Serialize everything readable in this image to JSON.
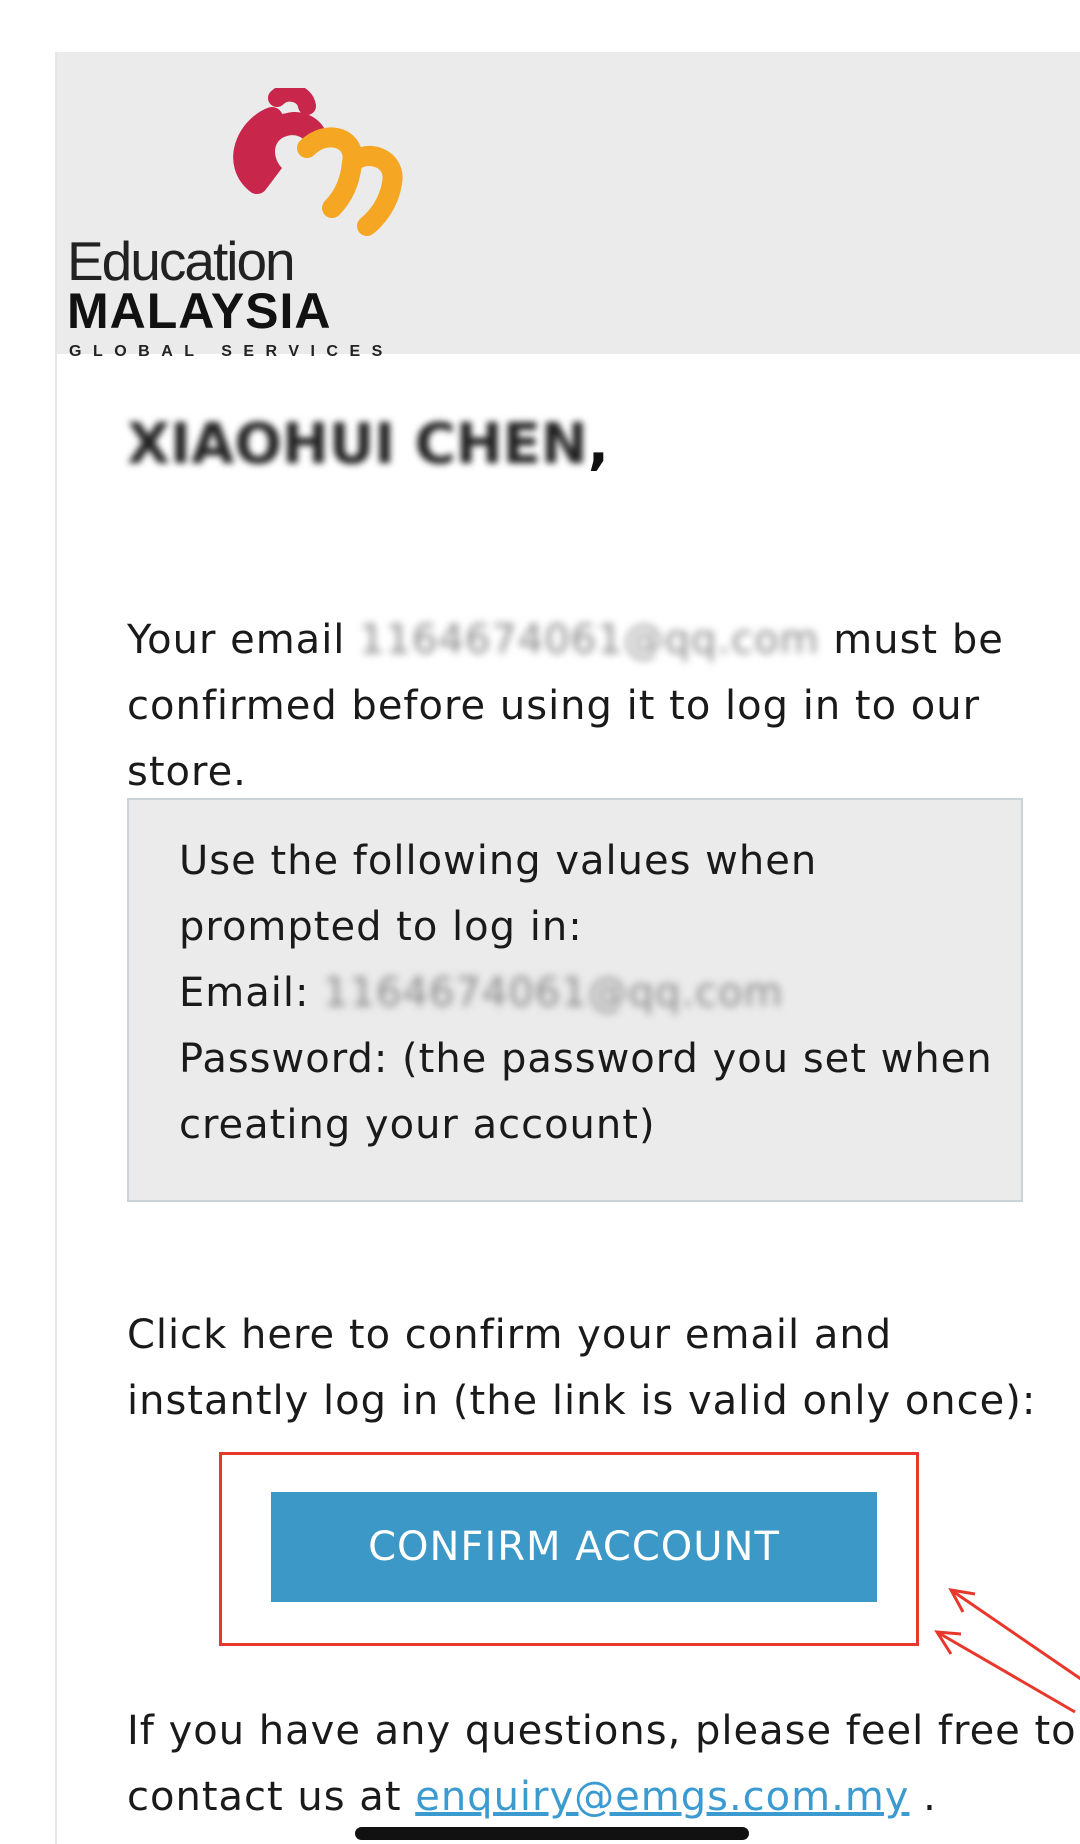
{
  "header": {
    "logo": {
      "word_top": "Education",
      "word_main": "MALAYSIA",
      "word_sub": "GLOBAL SERVICES",
      "mark_colors": [
        "#c8264a",
        "#f5a623"
      ]
    }
  },
  "email": {
    "greeting_name": "XIAOHUI CHEN",
    "greeting_punct": ",",
    "intro_before": "Your email ",
    "intro_email_redacted": "1164674061@qq.com",
    "intro_after": " must be confirmed before using it to log in to our store.",
    "credentials": {
      "line1": "Use the following values when prompted to log in:",
      "email_label": "Email: ",
      "email_value_redacted": "1164674061@qq.com",
      "password_line": "Password: (the password you set when creating your account)"
    },
    "click_here_text": "Click here to confirm your email and instantly log in (the link is valid only once):",
    "confirm_button_label": "CONFIRM ACCOUNT",
    "questions_text": "If you have any questions, please feel free to contact us at ",
    "contact_link": "enquiry@emgs.com.my",
    "questions_end": " ."
  },
  "colors": {
    "header_bg": "#ebebeb",
    "button_bg": "#3c98c6",
    "annotation_red": "#e8382c",
    "link": "#3b9bd1"
  }
}
